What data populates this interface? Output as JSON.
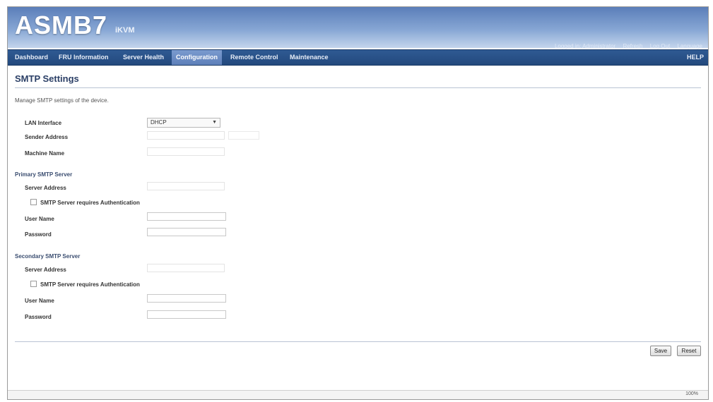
{
  "header": {
    "logo": "ASMB7",
    "logo_sub": "iKVM",
    "util_links": [
      "Logged in: Administrator",
      "Refresh",
      "Log Out",
      "Language"
    ]
  },
  "nav": {
    "tabs": [
      "Dashboard",
      "FRU Information",
      "Server Health",
      "Configuration",
      "Remote Control",
      "Maintenance"
    ],
    "active_tab": "Configuration",
    "help": "HELP"
  },
  "page": {
    "title": "SMTP Settings",
    "description": "Manage SMTP settings of the device."
  },
  "form": {
    "lan_interface": {
      "label": "LAN Interface",
      "value": "DHCP"
    },
    "sender_address": {
      "label": "Sender Address",
      "value": ""
    },
    "machine_name": {
      "label": "Machine Name",
      "value": ""
    },
    "primary": {
      "section": "Primary SMTP Server",
      "server_address": "Server Address",
      "auth_label": "SMTP Server requires Authentication",
      "user_name": "User Name",
      "password": "Password"
    },
    "secondary": {
      "section": "Secondary SMTP Server",
      "server_address": "Server Address",
      "auth_label": "SMTP Server requires Authentication",
      "user_name": "User Name",
      "password": "Password"
    }
  },
  "buttons": {
    "save": "Save",
    "reset": "Reset"
  },
  "status": {
    "zoom": "100%"
  },
  "colors": {
    "banner": "#5b7eb9",
    "navbar": "#2f5a93",
    "active_tab": "#7b9bcf"
  }
}
